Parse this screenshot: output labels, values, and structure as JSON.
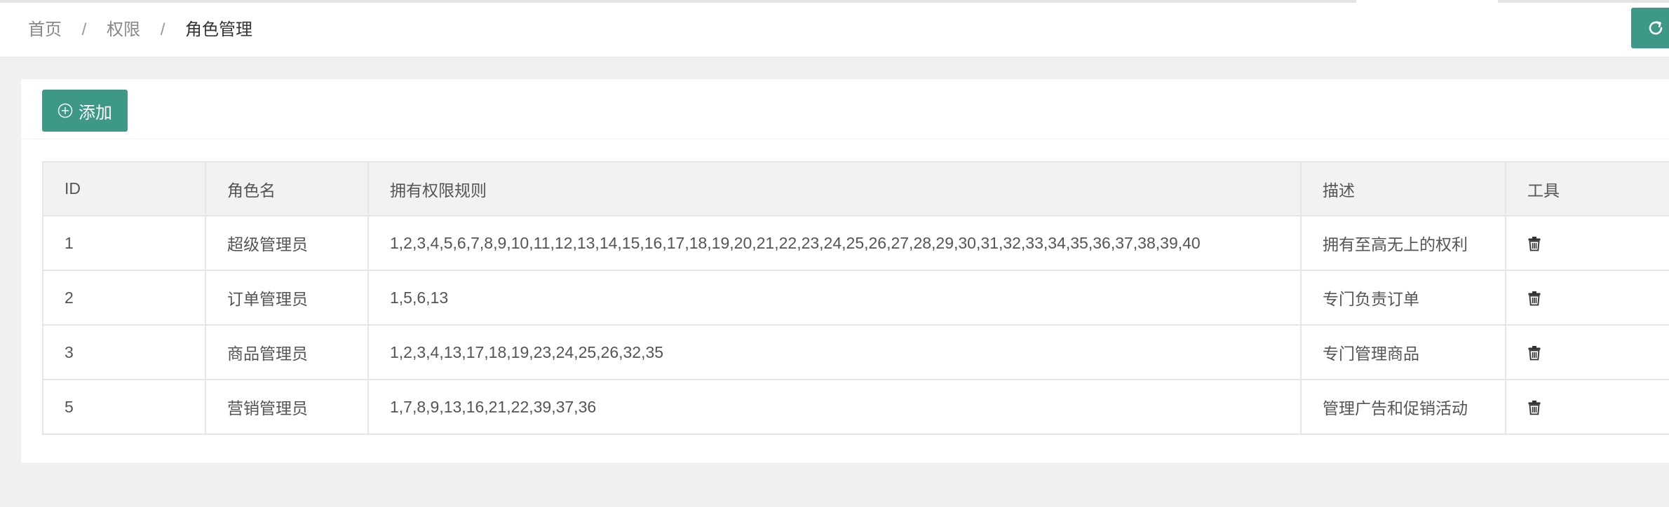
{
  "breadcrumb": {
    "items": [
      "首页",
      "权限",
      "角色管理"
    ],
    "separator": "/"
  },
  "header": {
    "refresh_icon": "refresh-icon"
  },
  "toolbar": {
    "add_label": "添加",
    "add_icon": "plus-circle-icon"
  },
  "table": {
    "columns": [
      "ID",
      "角色名",
      "拥有权限规则",
      "描述",
      "工具"
    ],
    "rows": [
      {
        "id": "1",
        "name": "超级管理员",
        "rules": "1,2,3,4,5,6,7,8,9,10,11,12,13,14,15,16,17,18,19,20,21,22,23,24,25,26,27,28,29,30,31,32,33,34,35,36,37,38,39,40",
        "desc": "拥有至高无上的权利",
        "tool_icon": "trash-icon"
      },
      {
        "id": "2",
        "name": "订单管理员",
        "rules": "1,5,6,13",
        "desc": "专门负责订单",
        "tool_icon": "trash-icon"
      },
      {
        "id": "3",
        "name": "商品管理员",
        "rules": "1,2,3,4,13,17,18,19,23,24,25,26,32,35",
        "desc": "专门管理商品",
        "tool_icon": "trash-icon"
      },
      {
        "id": "5",
        "name": "营销管理员",
        "rules": "1,7,8,9,13,16,21,22,39,37,36",
        "desc": "管理广告和促销活动",
        "tool_icon": "trash-icon"
      }
    ]
  },
  "colors": {
    "accent": "#3d9887",
    "header_bg": "#f2f2f2",
    "page_bg": "#f0f0f0"
  }
}
